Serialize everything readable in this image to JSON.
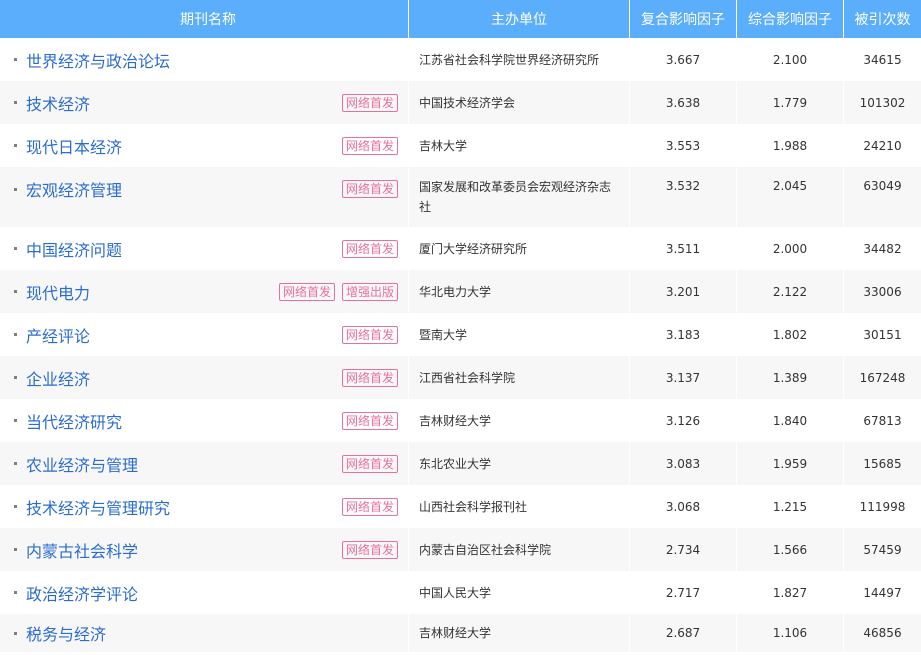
{
  "table": {
    "headers": {
      "journal": "期刊名称",
      "sponsor": "主办单位",
      "composite_if": "复合影响因子",
      "comprehensive_if": "综合影响因子",
      "citations": "被引次数"
    },
    "rows": [
      {
        "name": "世界经济与政治论坛",
        "badges": [],
        "sponsor": "江苏省社会科学院世界经济研究所",
        "composite_if": "3.667",
        "comprehensive_if": "2.100",
        "citations": "34615"
      },
      {
        "name": "技术经济",
        "badges": [
          "网络首发"
        ],
        "sponsor": "中国技术经济学会",
        "composite_if": "3.638",
        "comprehensive_if": "1.779",
        "citations": "101302"
      },
      {
        "name": "现代日本经济",
        "badges": [
          "网络首发"
        ],
        "sponsor": "吉林大学",
        "composite_if": "3.553",
        "comprehensive_if": "1.988",
        "citations": "24210"
      },
      {
        "name": "宏观经济管理",
        "badges": [
          "网络首发"
        ],
        "sponsor": "国家发展和改革委员会宏观经济杂志社",
        "composite_if": "3.532",
        "comprehensive_if": "2.045",
        "citations": "63049"
      },
      {
        "name": "中国经济问题",
        "badges": [
          "网络首发"
        ],
        "sponsor": "厦门大学经济研究所",
        "composite_if": "3.511",
        "comprehensive_if": "2.000",
        "citations": "34482"
      },
      {
        "name": "现代电力",
        "badges": [
          "网络首发",
          "增强出版"
        ],
        "sponsor": "华北电力大学",
        "composite_if": "3.201",
        "comprehensive_if": "2.122",
        "citations": "33006"
      },
      {
        "name": "产经评论",
        "badges": [
          "网络首发"
        ],
        "sponsor": "暨南大学",
        "composite_if": "3.183",
        "comprehensive_if": "1.802",
        "citations": "30151"
      },
      {
        "name": "企业经济",
        "badges": [
          "网络首发"
        ],
        "sponsor": "江西省社会科学院",
        "composite_if": "3.137",
        "comprehensive_if": "1.389",
        "citations": "167248"
      },
      {
        "name": "当代经济研究",
        "badges": [
          "网络首发"
        ],
        "sponsor": "吉林财经大学",
        "composite_if": "3.126",
        "comprehensive_if": "1.840",
        "citations": "67813"
      },
      {
        "name": "农业经济与管理",
        "badges": [
          "网络首发"
        ],
        "sponsor": "东北农业大学",
        "composite_if": "3.083",
        "comprehensive_if": "1.959",
        "citations": "15685"
      },
      {
        "name": "技术经济与管理研究",
        "badges": [
          "网络首发"
        ],
        "sponsor": "山西社会科学报刊社",
        "composite_if": "3.068",
        "comprehensive_if": "1.215",
        "citations": "111998"
      },
      {
        "name": "内蒙古社会科学",
        "badges": [
          "网络首发"
        ],
        "sponsor": "内蒙古自治区社会科学院",
        "composite_if": "2.734",
        "comprehensive_if": "1.566",
        "citations": "57459"
      },
      {
        "name": "政治经济学评论",
        "badges": [],
        "sponsor": "中国人民大学",
        "composite_if": "2.717",
        "comprehensive_if": "1.827",
        "citations": "14497"
      },
      {
        "name": "税务与经济",
        "badges": [],
        "sponsor": "吉林财经大学",
        "composite_if": "2.687",
        "comprehensive_if": "1.106",
        "citations": "46856"
      }
    ]
  },
  "colors": {
    "header_bg": "#5aaefb",
    "title_link": "#2b6cd1",
    "badge": "#e8719a",
    "row_alt": "#f7f7f7"
  }
}
